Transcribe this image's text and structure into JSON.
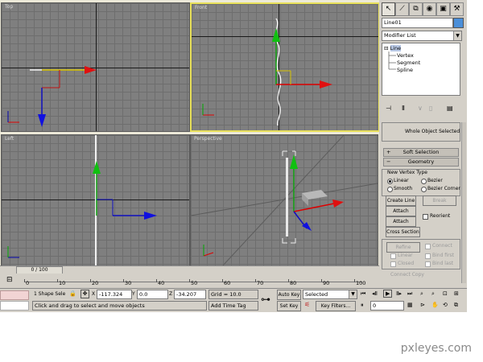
{
  "viewports": {
    "top": {
      "label": "Top"
    },
    "front": {
      "label": "Front"
    },
    "left": {
      "label": "Left"
    },
    "perspective": {
      "label": "Perspective"
    }
  },
  "gizmo_axis": {
    "x": "x",
    "y": "y",
    "z": "z"
  },
  "command_panel": {
    "object_name": "Line01",
    "object_color": "#4b8fd9",
    "modifier_list": "Modifier List",
    "stack": {
      "root": "Line",
      "children": [
        "Vertex",
        "Segment",
        "Spline"
      ]
    },
    "selection_info": "Whole Object Selected",
    "soft_selection": "Soft Selection",
    "geometry": "Geometry",
    "new_vertex_type": {
      "title": "New Vertex Type",
      "linear": "Linear",
      "bezier": "Bezier",
      "smooth": "Smooth",
      "bezier_corner": "Bezier Corner"
    },
    "buttons": {
      "create_line": "Create Line",
      "break": "Break",
      "attach": "Attach",
      "attach_mult": "Attach Mult.",
      "reorient": "Reorient",
      "cross_section": "Cross Section",
      "refine": "Refine",
      "connect": "Connect",
      "linear": "Linear",
      "bind_first": "Bind first",
      "closed": "Closed",
      "bind_last": "Bind last",
      "connect_copy": "Connect Copy"
    }
  },
  "time_slider": {
    "label": "0 / 100"
  },
  "trackbar": {
    "ticks": [
      "0",
      "10",
      "20",
      "30",
      "40",
      "50",
      "60",
      "70",
      "80",
      "90",
      "100"
    ]
  },
  "status": {
    "selection": "1 Shape Sele",
    "prompt": "Click and drag to select and move objects",
    "x_label": "X",
    "x_value": "-117.324",
    "y_label": "Y",
    "y_value": "0.0",
    "z_label": "Z",
    "z_value": "-34.207",
    "grid": "Grid = 10.0",
    "add_time_tag": "Add Time Tag",
    "auto_key": "Auto Key",
    "set_key": "Set Key",
    "selected": "Selected",
    "key_filters": "Key Filters...",
    "frame": "0"
  },
  "watermark": "pxleyes.com"
}
